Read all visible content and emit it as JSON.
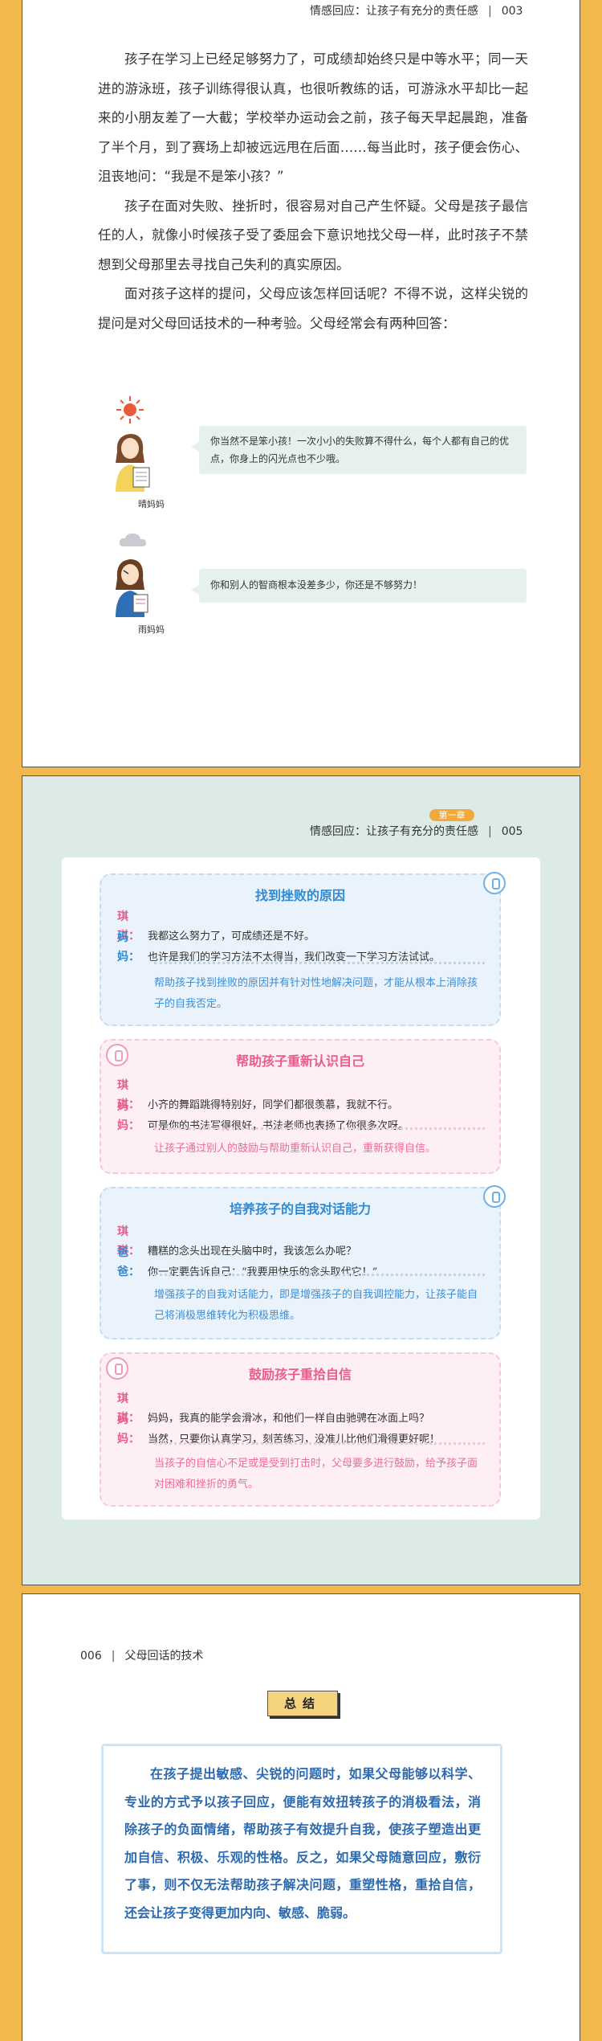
{
  "page1": {
    "running_head": "情感回应：让孩子有充分的责任感",
    "page_number": "003",
    "paragraphs": [
      "孩子在学习上已经足够努力了，可成绩却始终只是中等水平；同一天进的游泳班，孩子训练得很认真，也很听教练的话，可游泳水平却比一起来的小朋友差了一大截；学校举办运动会之前，孩子每天早起晨跑，准备了半个月，到了赛场上却被远远甩在后面……每当此时，孩子便会伤心、沮丧地问：“我是不是笨小孩？”",
      "孩子在面对失败、挫折时，很容易对自己产生怀疑。父母是孩子最信任的人，就像小时候孩子受了委屈会下意识地找父母一样，此时孩子不禁想到父母那里去寻找自己失利的真实原因。",
      "面对孩子这样的提问，父母应该怎样回话呢？不得不说，这样尖锐的提问是对父母回话技术的一种考验。父母经常会有两种回答："
    ],
    "moms": [
      {
        "caption": "晴妈妈",
        "weather_icon": "sun-icon",
        "speech": "你当然不是笨小孩！一次小小的失败算不得什么，每个人都有自己的优点，你身上的闪光点也不少哦。"
      },
      {
        "caption": "雨妈妈",
        "weather_icon": "cloud-icon",
        "speech": "你和别人的智商根本没差多少，你还是不够努力！"
      }
    ]
  },
  "page2": {
    "chapter_tag": "第一章",
    "running_head": "情感回应：让孩子有充分的责任感",
    "page_number": "005",
    "cards": [
      {
        "title": "找到挫败的原因",
        "lines": [
          {
            "speaker": "琪琪：",
            "text": "我都这么努力了，可成绩还是不好。"
          },
          {
            "speaker": "妈妈：",
            "text": "也许是我们的学习方法不太得当，我们改变一下学习方法试试。"
          }
        ],
        "note": "帮助孩子找到挫败的原因并有针对性地解决问题，才能从根本上消除孩子的自我否定。"
      },
      {
        "title": "帮助孩子重新认识自己",
        "lines": [
          {
            "speaker": "琪琪：",
            "text": "小齐的舞蹈跳得特别好，同学们都很羡慕，我就不行。"
          },
          {
            "speaker": "妈妈：",
            "text": "可是你的书法写得很好，书法老师也表扬了你很多次呀。"
          }
        ],
        "note": "让孩子通过别人的鼓励与帮助重新认识自己，重新获得自信。"
      },
      {
        "title": "培养孩子的自我对话能力",
        "lines": [
          {
            "speaker": "琪琪：",
            "text": "糟糕的念头出现在头脑中时，我该怎么办呢？"
          },
          {
            "speaker": "爸爸：",
            "text": "你一定要告诉自己：“我要用快乐的念头取代它！”"
          }
        ],
        "note": "增强孩子的自我对话能力，即是增强孩子的自我调控能力，让孩子能自己将消极思维转化为积极思维。"
      },
      {
        "title": "鼓励孩子重拾自信",
        "lines": [
          {
            "speaker": "琪琪：",
            "text": "妈妈，我真的能学会滑冰，和他们一样自由驰骋在冰面上吗？"
          },
          {
            "speaker": "妈妈：",
            "text": "当然，只要你认真学习，刻苦练习，没准儿比他们滑得更好呢！"
          }
        ],
        "note": "当孩子的自信心不足或是受到打击时，父母要多进行鼓励，给予孩子面对困难和挫折的勇气。"
      }
    ]
  },
  "page3": {
    "page_number": "006",
    "running_head": "父母回话的技术",
    "summary_title": "总结",
    "summary_text": "在孩子提出敏感、尖锐的问题时，如果父母能够以科学、专业的方式予以孩子回应，便能有效扭转孩子的消极看法，消除孩子的负面情绪，帮助孩子有效提升自我，使孩子塑造出更加自信、积极、乐观的性格。反之，如果父母随意回应，敷衍了事，则不仅无法帮助孩子解决问题，重塑性格，重拾自信，还会让孩子变得更加内向、敏感、脆弱。"
  },
  "colors": {
    "background": "#f2b84b",
    "panel_teal": "#dcebe6",
    "blue_accent": "#2e8bd3",
    "pink_accent": "#e85c8e",
    "summary_blue": "#2c6ab0",
    "chapter_orange": "#f0a93a"
  }
}
